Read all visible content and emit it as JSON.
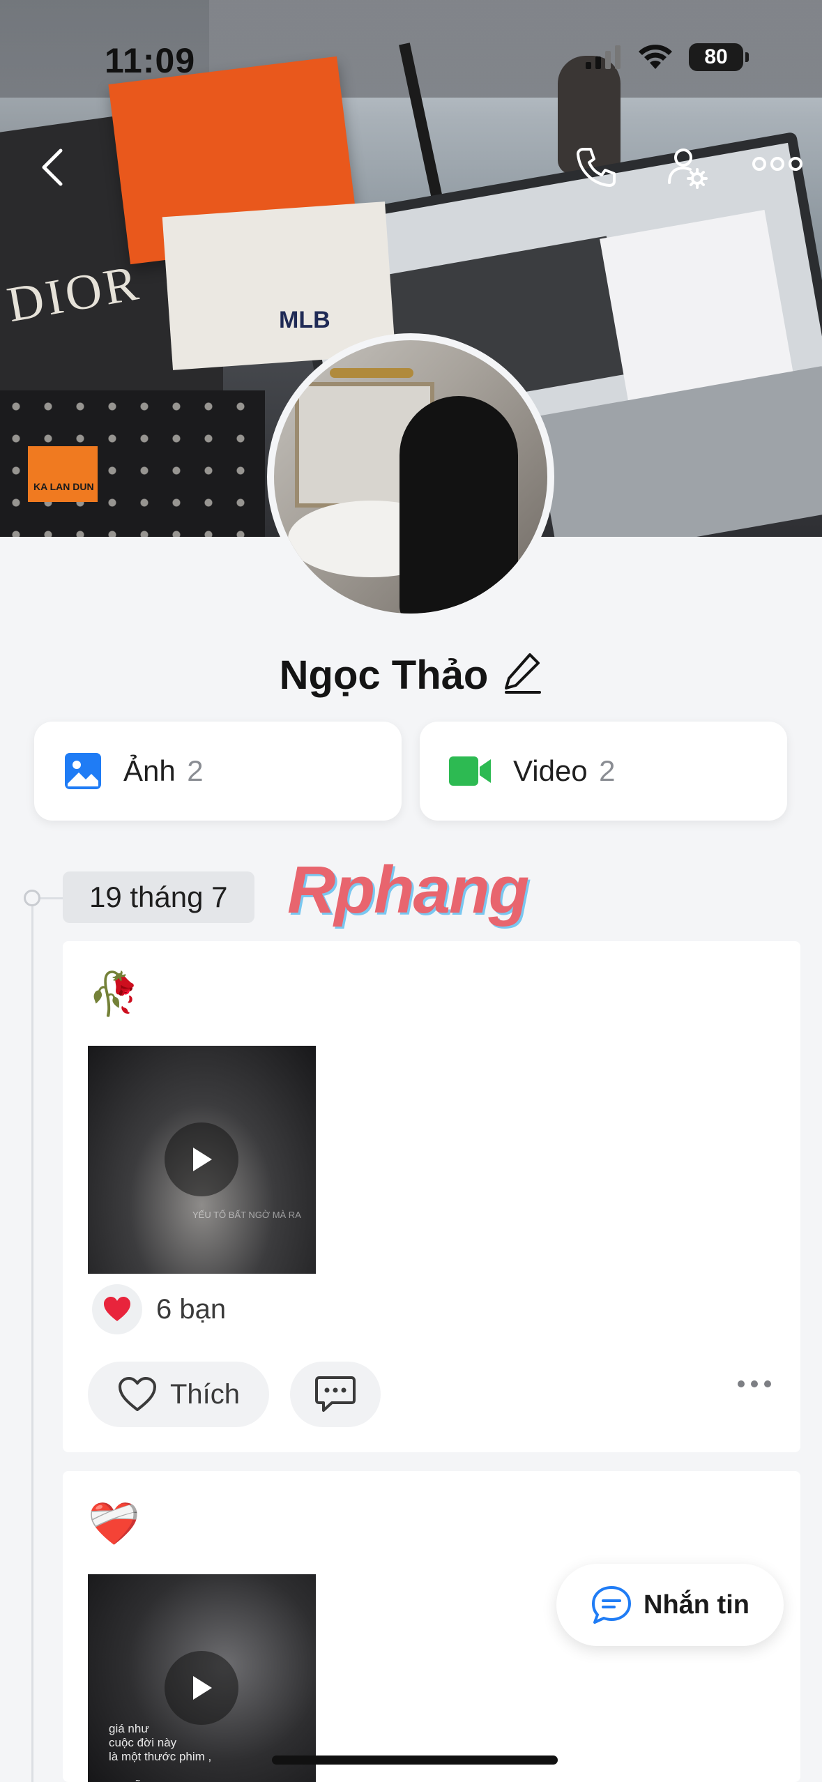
{
  "status_bar": {
    "time": "11:09",
    "battery": "80"
  },
  "header": {
    "back_icon": "chevron-left-icon",
    "call_icon": "phone-icon",
    "settings_icon": "user-settings-icon",
    "more_icon": "more-horizontal-icon"
  },
  "cover": {
    "dior_text": "DIOR",
    "mlb_text": "MLB",
    "tag_text": "KA LAN DUN"
  },
  "profile": {
    "name": "Ngọc Thảo",
    "edit_icon": "pencil-icon"
  },
  "media": [
    {
      "label": "Ảnh",
      "count": "2",
      "icon": "image-icon",
      "color": "#1f7cf5"
    },
    {
      "label": "Video",
      "count": "2",
      "icon": "video-camera-icon",
      "color": "#2dba52"
    }
  ],
  "timeline": {
    "date": "19 tháng 7",
    "watermark": "Rphang"
  },
  "posts": [
    {
      "emoji": "🥀",
      "thumb_caption": "YẾU TỐ BẤT NGỜ MÀ RA",
      "reaction_count_text": "6 bạn",
      "like_label": "Thích"
    },
    {
      "emoji": "❤️‍🩹",
      "thumb_lyrics": "giá như\ncuộc đời này\nlà một thước phim ,\n\nem sẽ"
    }
  ],
  "actions": {
    "message_label": "Nhắn tin"
  }
}
